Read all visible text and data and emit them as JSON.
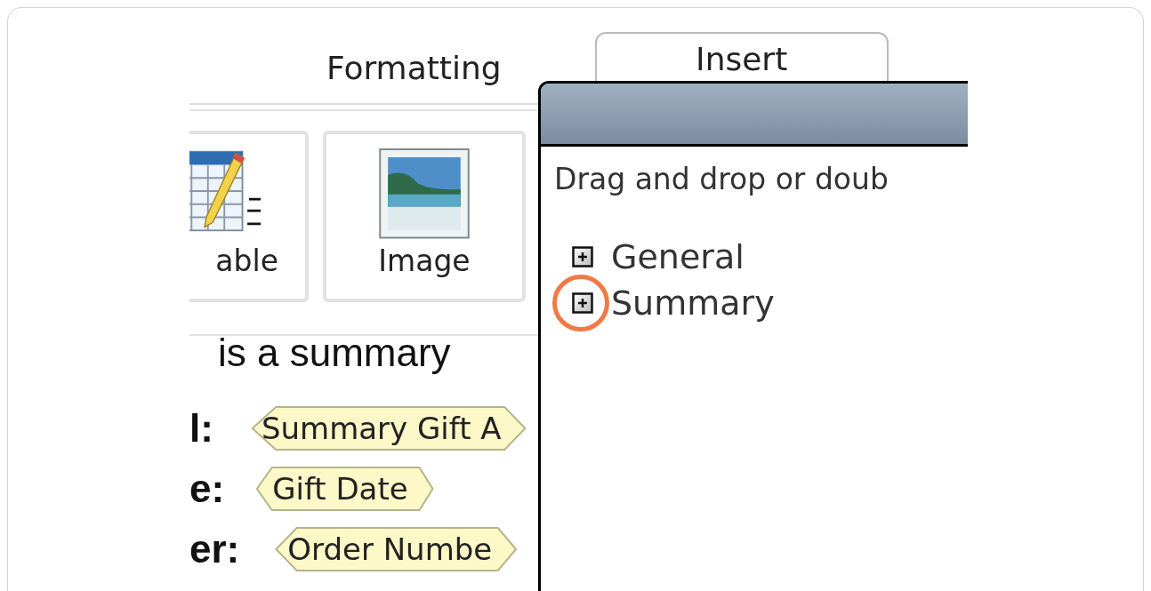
{
  "tabs": [
    {
      "label": "Formatting",
      "selected": false
    },
    {
      "label": "Insert",
      "selected": true
    }
  ],
  "ribbon_buttons": [
    {
      "kind": "table",
      "label": "able"
    },
    {
      "kind": "image",
      "label": "Image"
    }
  ],
  "document": {
    "heading": "is a summary",
    "fields": [
      {
        "label": "l:",
        "tag": "Summary Gift A"
      },
      {
        "label": "e:",
        "tag": "Gift Date"
      },
      {
        "label": "er:",
        "tag": "Order Numbe"
      }
    ]
  },
  "dialog": {
    "instruction": "Drag and drop or doub",
    "tree": [
      {
        "label": "General",
        "expanded": false,
        "highlighted": false
      },
      {
        "label": "Summary",
        "expanded": false,
        "highlighted": true
      }
    ]
  }
}
